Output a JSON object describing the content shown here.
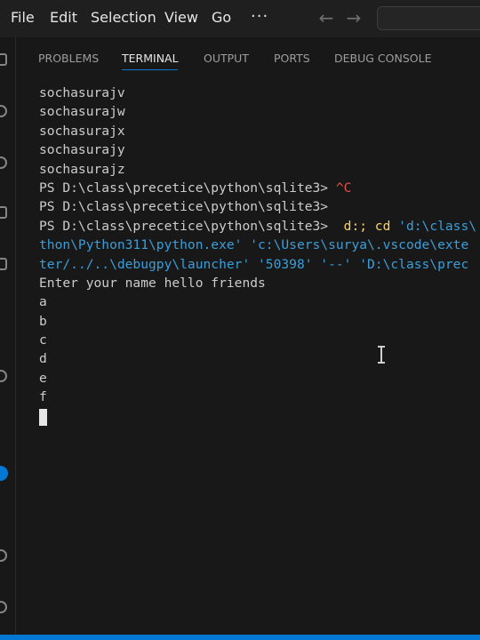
{
  "menu": {
    "file": "File",
    "edit": "Edit",
    "selection": "Selection",
    "view": "View",
    "go": "Go",
    "more": "···"
  },
  "nav": {
    "back_icon": "arrow-left-icon",
    "forward_icon": "arrow-right-icon"
  },
  "panel": {
    "tabs": [
      "PROBLEMS",
      "TERMINAL",
      "OUTPUT",
      "PORTS",
      "DEBUG CONSOLE"
    ],
    "active_tab": "TERMINAL"
  },
  "terminal": {
    "output_lines": [
      "sochasurajv",
      "sochasurajw",
      "sochasurajx",
      "sochasurajy",
      "sochasurajz"
    ],
    "prompt": "PS D:\\class\\precetice\\python\\sqlite3> ",
    "ctrl_c": "^C",
    "run_cmd_prefix": " d:; cd ",
    "run_cmd_path": "'d:\\class\\",
    "cont_line_1": "thon\\Python311\\python.exe' 'c:\\Users\\surya\\.vscode\\exte",
    "cont_line_2": "ter/../..\\debugpy\\launcher' '50398' '--' 'D:\\class\\prec",
    "program_output": [
      "Enter your name hello friends",
      "a",
      "b",
      "c",
      "d",
      "e",
      "f"
    ]
  },
  "colors": {
    "accent": "#0078d4",
    "command": "#f5d46c",
    "string": "#3b9ed9",
    "interrupt": "#f14c4c"
  }
}
